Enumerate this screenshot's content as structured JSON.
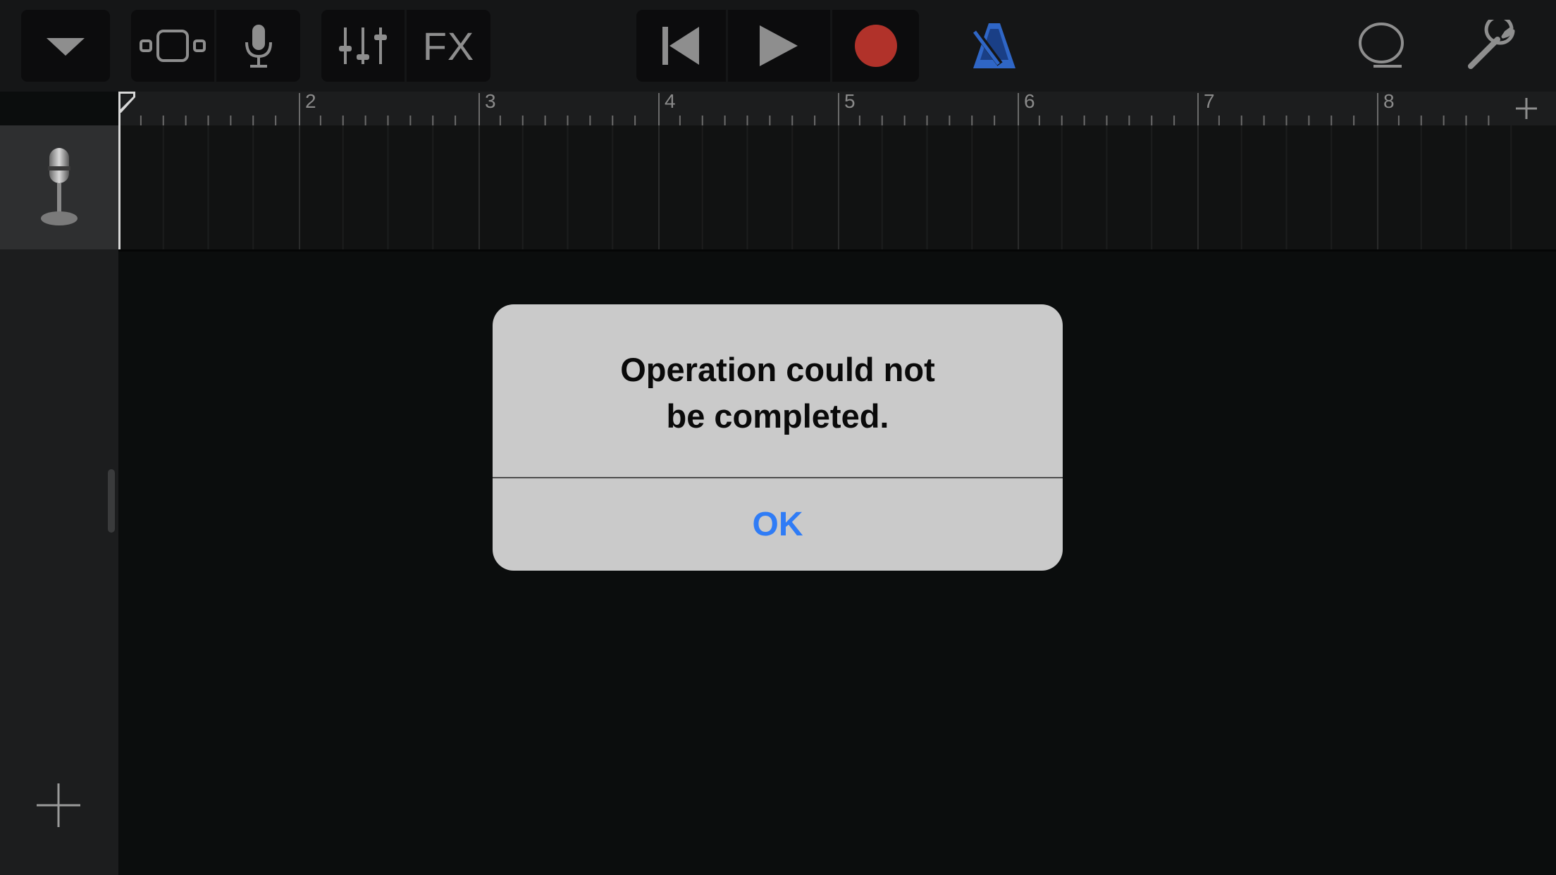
{
  "toolbar": {
    "fx_label": "FX",
    "icons": [
      "chevron-down-icon",
      "tracks-view-icon",
      "microphone-icon",
      "mixer-sliders-icon",
      "rewind-icon",
      "play-icon",
      "record-icon",
      "metronome-icon",
      "loop-browser-icon",
      "settings-wrench-icon"
    ]
  },
  "ruler": {
    "bars": [
      "2",
      "3",
      "4",
      "5",
      "6",
      "7",
      "8"
    ]
  },
  "track": {
    "instrument_icon": "audio-recorder-microphone-icon"
  },
  "dialog": {
    "title": "Operation could not\nbe completed.",
    "ok_label": "OK"
  },
  "colors": {
    "record": "#b1322a",
    "metronome": "#2f66c6",
    "alert_button": "#2f7cf6",
    "alert_background": "#cacaca"
  }
}
